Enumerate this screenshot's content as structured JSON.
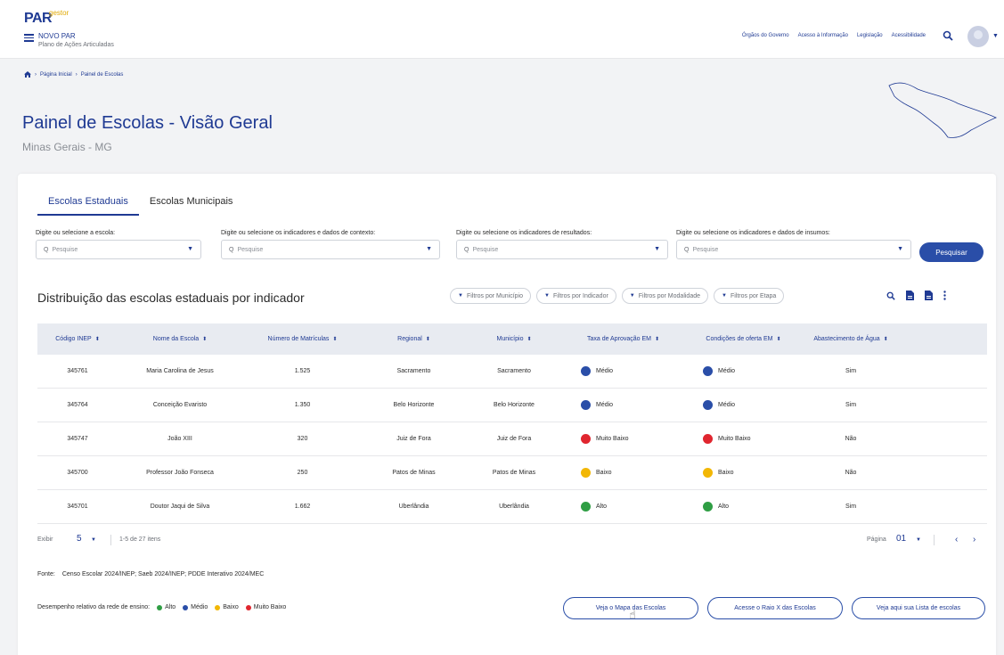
{
  "header": {
    "logo_text": "PAR",
    "logo_tag": "gestor",
    "app_name": "NOVO PAR",
    "app_subtitle": "Plano de Ações Articuladas",
    "links": [
      "Órgãos do Governo",
      "Acesso à Informação",
      "Legislação",
      "Acessibilidade"
    ]
  },
  "breadcrumb": [
    "Página Inicial",
    "Painel de Escolas"
  ],
  "page": {
    "title": "Painel de Escolas - Visão Geral",
    "subtitle": "Minas Gerais - MG"
  },
  "tabs": [
    {
      "label": "Escolas Estaduais",
      "active": true
    },
    {
      "label": "Escolas Municipais",
      "active": false
    }
  ],
  "filters": [
    {
      "label": "Digite ou selecione a escola:",
      "placeholder": "Pesquise"
    },
    {
      "label": "Digite ou selecione os indicadores e dados de contexto:",
      "placeholder": "Pesquise"
    },
    {
      "label": "Digite ou selecione os indicadores de resultados:",
      "placeholder": "Pesquise"
    },
    {
      "label": "Digite ou selecione os indicadores e dados de insumos:",
      "placeholder": "Pesquise"
    }
  ],
  "search_button": "Pesquisar",
  "section_title": "Distribuição das escolas estaduais por indicador",
  "chips": [
    "Filtros por Município",
    "Filtros por Indicador",
    "Filtros por Modalidade",
    "Filtros por Etapa"
  ],
  "table": {
    "headers": [
      "Código INEP",
      "Nome da Escola",
      "Número de Matrículas",
      "Regional",
      "Município",
      "Taxa de Aprovação EM",
      "Condições de oferta EM",
      "Abastecimento de Água"
    ],
    "rows": [
      {
        "codigo": "345761",
        "nome": "Maria Carolina de Jesus",
        "matriculas": "1.525",
        "regional": "Sacramento",
        "municipio": "Sacramento",
        "taxa": "Médio",
        "taxa_color": "#2a4ea8",
        "cond": "Médio",
        "cond_color": "#2a4ea8",
        "agua": "Sim"
      },
      {
        "codigo": "345764",
        "nome": "Conceição Evaristo",
        "matriculas": "1.350",
        "regional": "Belo Horizonte",
        "municipio": "Belo Horizonte",
        "taxa": "Médio",
        "taxa_color": "#2a4ea8",
        "cond": "Médio",
        "cond_color": "#2a4ea8",
        "agua": "Sim"
      },
      {
        "codigo": "345747",
        "nome": "João XIII",
        "matriculas": "320",
        "regional": "Juiz de Fora",
        "municipio": "Juiz de Fora",
        "taxa": "Muito Baixo",
        "taxa_color": "#e0262f",
        "cond": "Muito Baixo",
        "cond_color": "#e0262f",
        "agua": "Não"
      },
      {
        "codigo": "345700",
        "nome": "Professor João Fonseca",
        "matriculas": "250",
        "regional": "Patos de Minas",
        "municipio": "Patos de Minas",
        "taxa": "Baixo",
        "taxa_color": "#f2b705",
        "cond": "Baixo",
        "cond_color": "#f2b705",
        "agua": "Não"
      },
      {
        "codigo": "345701",
        "nome": "Doutor Jaqui de Silva",
        "matriculas": "1.662",
        "regional": "Uberlândia",
        "municipio": "Uberlândia",
        "taxa": "Alto",
        "taxa_color": "#2f9e44",
        "cond": "Alto",
        "cond_color": "#2f9e44",
        "agua": "Sim"
      }
    ]
  },
  "pagination": {
    "exibir_label": "Exibir",
    "per_page": "5",
    "count_text": "1-5 de 27 itens",
    "pagina_label": "Página",
    "page": "01"
  },
  "fonte": {
    "label": "Fonte:",
    "text": "Censo Escolar 2024/INEP; Saeb 2024/INEP; PDDE Interativo 2024/MEC"
  },
  "legend": {
    "label": "Desempenho relativo da rede de ensino:",
    "items": [
      {
        "label": "Alto",
        "color": "#2f9e44"
      },
      {
        "label": "Médio",
        "color": "#2a4ea8"
      },
      {
        "label": "Baixo",
        "color": "#f2b705"
      },
      {
        "label": "Muito Baixo",
        "color": "#e0262f"
      }
    ]
  },
  "actions": [
    "Veja o Mapa das Escolas",
    "Acesse o Raio X das Escolas",
    "Veja aqui sua Lista de escolas"
  ]
}
